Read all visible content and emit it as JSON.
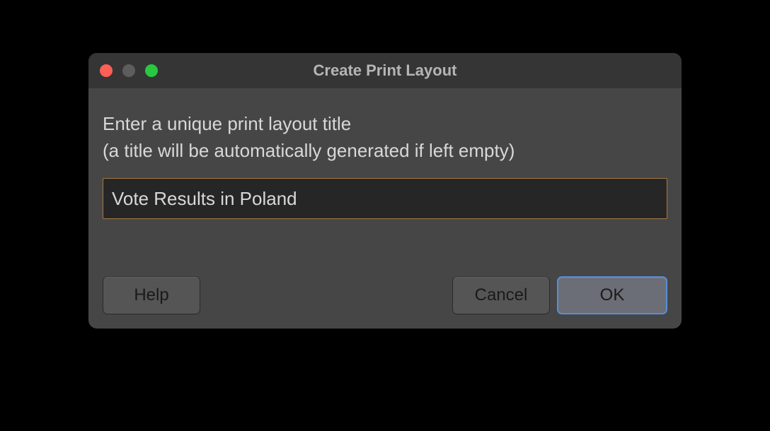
{
  "dialog": {
    "title": "Create Print Layout",
    "prompt_line1": "Enter a unique print layout title",
    "prompt_line2": "(a title will be automatically generated if left empty)",
    "input_value": "Vote Results in Poland",
    "buttons": {
      "help": "Help",
      "cancel": "Cancel",
      "ok": "OK"
    }
  }
}
